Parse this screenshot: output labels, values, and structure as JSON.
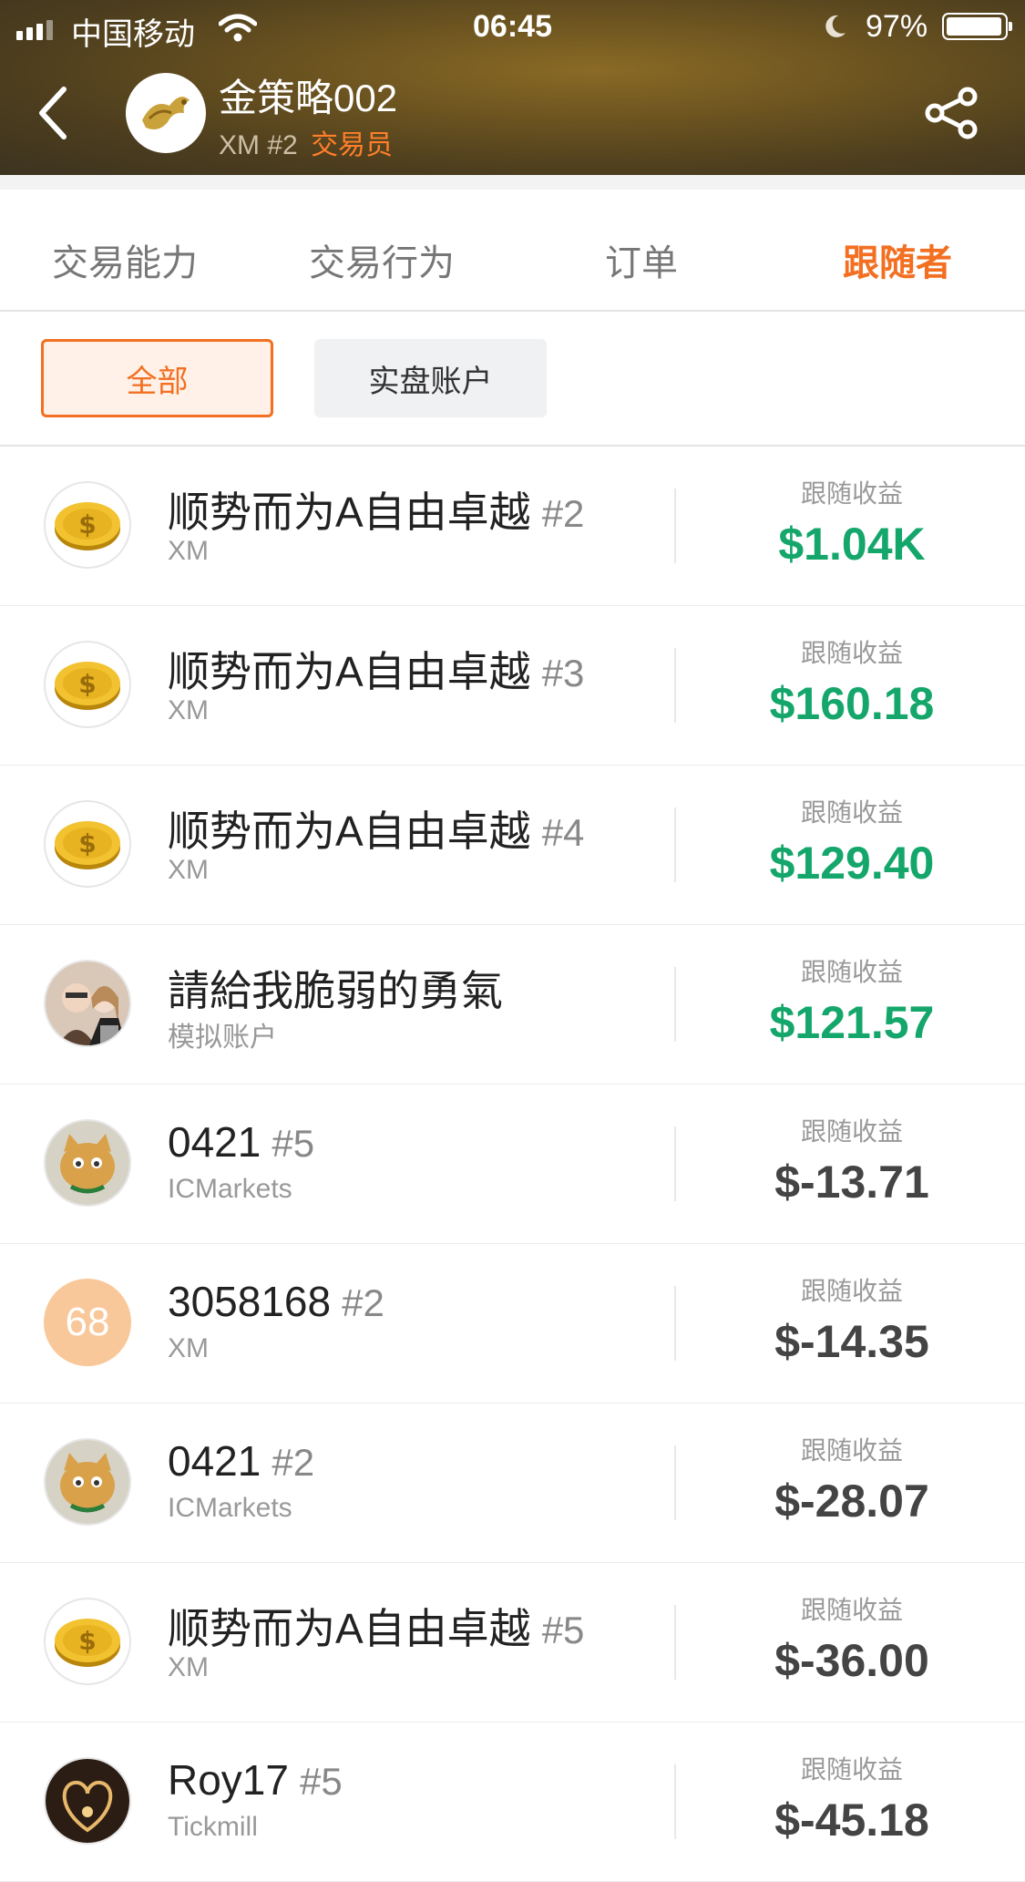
{
  "status_bar": {
    "carrier": "中国移动",
    "time": "06:45",
    "battery": "97%",
    "battery_level": 0.97
  },
  "header": {
    "strategy_name": "金策略002",
    "broker": "XM",
    "account_tag": "#2",
    "role": "交易员",
    "icons": [
      "back-arrow-icon",
      "dragon-avatar",
      "share-icon"
    ]
  },
  "tabs": [
    {
      "label": "交易能力",
      "active": false
    },
    {
      "label": "交易行为",
      "active": false
    },
    {
      "label": "订单",
      "active": false
    },
    {
      "label": "跟随者",
      "active": true
    }
  ],
  "filters": [
    {
      "label": "全部",
      "active": true
    },
    {
      "label": "实盘账户",
      "active": false
    }
  ],
  "followers": [
    {
      "name": "顺势而为A自由卓越",
      "tag": "#2",
      "broker": "XM",
      "profit_label": "跟随收益",
      "profit": "$1.04K",
      "sign": "pos",
      "avatar": "coin"
    },
    {
      "name": "顺势而为A自由卓越",
      "tag": "#3",
      "broker": "XM",
      "profit_label": "跟随收益",
      "profit": "$160.18",
      "sign": "pos",
      "avatar": "coin"
    },
    {
      "name": "顺势而为A自由卓越",
      "tag": "#4",
      "broker": "XM",
      "profit_label": "跟随收益",
      "profit": "$129.40",
      "sign": "pos",
      "avatar": "coin"
    },
    {
      "name": "請給我脆弱的勇氣",
      "tag": "",
      "broker": "模拟账户",
      "profit_label": "跟随收益",
      "profit": "$121.57",
      "sign": "pos",
      "avatar": "couple"
    },
    {
      "name": "0421",
      "tag": "#5",
      "broker": "ICMarkets",
      "profit_label": "跟随收益",
      "profit": "$-13.71",
      "sign": "neg",
      "avatar": "cat"
    },
    {
      "name": "3058168",
      "tag": "#2",
      "broker": "XM",
      "profit_label": "跟随收益",
      "profit": "$-14.35",
      "sign": "neg",
      "avatar": "68"
    },
    {
      "name": "0421",
      "tag": "#2",
      "broker": "ICMarkets",
      "profit_label": "跟随收益",
      "profit": "$-28.07",
      "sign": "neg",
      "avatar": "cat"
    },
    {
      "name": "顺势而为A自由卓越",
      "tag": "#5",
      "broker": "XM",
      "profit_label": "跟随收益",
      "profit": "$-36.00",
      "sign": "neg",
      "avatar": "coin"
    },
    {
      "name": "Roy17",
      "tag": "#5",
      "broker": "Tickmill",
      "profit_label": "跟随收益",
      "profit": "$-45.18",
      "sign": "neg",
      "avatar": "heart"
    }
  ],
  "colors": {
    "accent": "#f36f21",
    "positive": "#14a66a",
    "negative": "#444444"
  }
}
